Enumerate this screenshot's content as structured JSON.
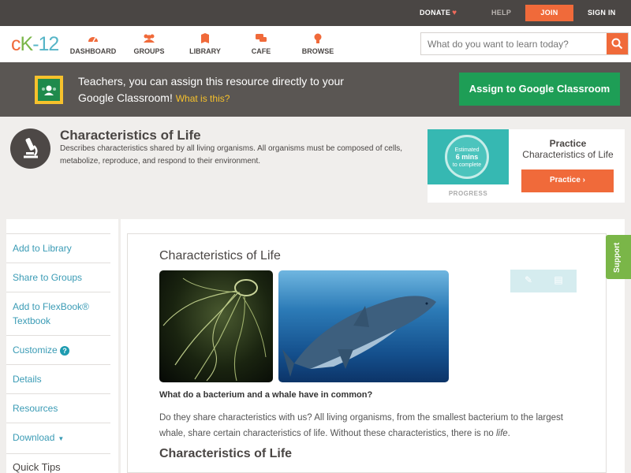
{
  "topbar": {
    "donate": "DONATE",
    "heart_icon": "heart-icon",
    "help": "HELP",
    "join": "JOIN",
    "sign_in": "SIGN IN"
  },
  "logo": {
    "c": "c",
    "k": "K",
    "n": "-12"
  },
  "nav": {
    "dashboard": "DASHBOARD",
    "groups": "GROUPS",
    "library": "LIBRARY",
    "cafe": "CAFE",
    "browse": "BROWSE"
  },
  "search": {
    "placeholder": "What do you want to learn today?"
  },
  "banner": {
    "text": "Teachers, you can assign this resource directly to your Google Classroom!",
    "what_link": "What is this?",
    "button": "Assign to Google Classroom"
  },
  "concept": {
    "title": "Characteristics of Life",
    "description": "Describes characteristics shared by all living organisms. All organisms must be composed of cells, metabolize, reproduce, and respond to their environment."
  },
  "practice": {
    "estimated": "Estimated",
    "mins": "6 mins",
    "to_complete": "to complete",
    "progress": "PROGRESS",
    "label": "Practice",
    "title": "Characteristics of Life",
    "button": "Practice"
  },
  "sidebar": {
    "add_library": "Add to Library",
    "share_groups": "Share to Groups",
    "add_flexbook": "Add to FlexBook® Textbook",
    "customize": "Customize",
    "details": "Details",
    "resources": "Resources",
    "download": "Download",
    "quick_tips": "Quick Tips"
  },
  "article": {
    "title": "Characteristics of Life",
    "question": "What do a bacterium and a whale have in common?",
    "paragraph_start": "Do they share characteristics with us? All living organisms, from the smallest bacterium to the largest whale, share certain characteristics of life. Without these characteristics, there is no ",
    "paragraph_em": "life",
    "paragraph_end": ".",
    "heading": "Characteristics of Life"
  },
  "support": "Support",
  "colors": {
    "accent": "#f06a3a",
    "green": "#1e9e56",
    "link": "#3a9bb5",
    "support": "#7ab648"
  }
}
